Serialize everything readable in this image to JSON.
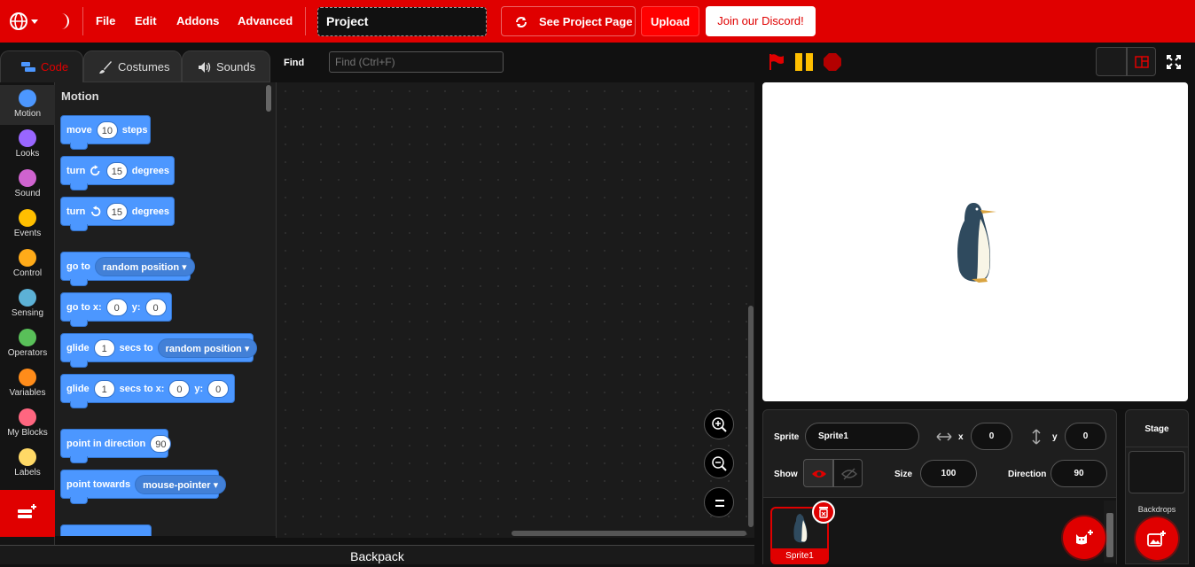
{
  "menu": {
    "file": "File",
    "edit": "Edit",
    "addons": "Addons",
    "advanced": "Advanced",
    "project_title": "Project",
    "see_project_page": "See Project Page",
    "upload": "Upload",
    "discord": "Join our Discord!"
  },
  "tabs": {
    "code": "Code",
    "costumes": "Costumes",
    "sounds": "Sounds"
  },
  "find": {
    "label": "Find",
    "placeholder": "Find (Ctrl+F)"
  },
  "categories": [
    {
      "label": "Motion",
      "color": "#4c97ff"
    },
    {
      "label": "Looks",
      "color": "#9966ff"
    },
    {
      "label": "Sound",
      "color": "#cf63cf"
    },
    {
      "label": "Events",
      "color": "#ffbf00"
    },
    {
      "label": "Control",
      "color": "#ffab19"
    },
    {
      "label": "Sensing",
      "color": "#5cb1d6"
    },
    {
      "label": "Operators",
      "color": "#59c059"
    },
    {
      "label": "Variables",
      "color": "#ff8c1a"
    },
    {
      "label": "My Blocks",
      "color": "#ff6680"
    },
    {
      "label": "Labels",
      "color": "#ffd966"
    }
  ],
  "palette": {
    "heading": "Motion",
    "move": {
      "w1": "move",
      "v1": "10",
      "w2": "steps"
    },
    "turn_right": {
      "w1": "turn",
      "v1": "15",
      "w2": "degrees"
    },
    "turn_left": {
      "w1": "turn",
      "v1": "15",
      "w2": "degrees"
    },
    "goto": {
      "w1": "go to",
      "d1": "random position"
    },
    "goto_xy": {
      "w1": "go to x:",
      "v1": "0",
      "w2": "y:",
      "v2": "0"
    },
    "glide": {
      "w1": "glide",
      "v1": "1",
      "w2": "secs to",
      "d1": "random position"
    },
    "glide_xy": {
      "w1": "glide",
      "v1": "1",
      "w2": "secs to x:",
      "v2": "0",
      "w3": "y:",
      "v3": "0"
    },
    "point_dir": {
      "w1": "point in direction",
      "v1": "90"
    },
    "point_towards": {
      "w1": "point towards",
      "d1": "mouse-pointer"
    }
  },
  "sprite_info": {
    "sprite_label": "Sprite",
    "sprite_name": "Sprite1",
    "x_label": "x",
    "x_value": "0",
    "y_label": "y",
    "y_value": "0",
    "show_label": "Show",
    "size_label": "Size",
    "size_value": "100",
    "direction_label": "Direction",
    "direction_value": "90"
  },
  "sprites": [
    {
      "name": "Sprite1"
    }
  ],
  "stage_panel": {
    "title": "Stage",
    "backdrops": "Backdrops"
  },
  "backpack": "Backpack",
  "colors": {
    "accent": "#e00000",
    "motion": "#4c97ff"
  }
}
